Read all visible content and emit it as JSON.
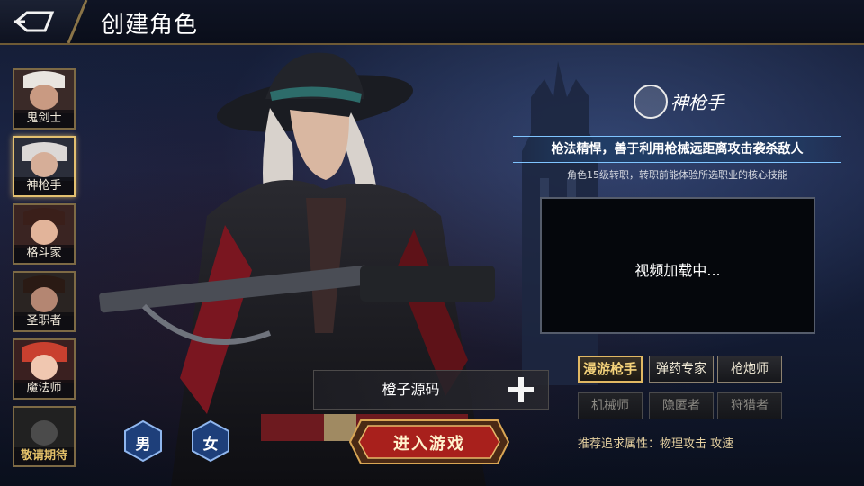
{
  "header": {
    "title": "创建角色"
  },
  "classes": [
    {
      "label": "鬼剑士",
      "selected": false,
      "locked": false
    },
    {
      "label": "神枪手",
      "selected": true,
      "locked": false
    },
    {
      "label": "格斗家",
      "selected": false,
      "locked": false
    },
    {
      "label": "圣职者",
      "selected": false,
      "locked": false
    },
    {
      "label": "魔法师",
      "selected": false,
      "locked": false
    },
    {
      "label": "敬请期待",
      "selected": false,
      "locked": true
    }
  ],
  "class_info": {
    "name": "神枪手",
    "description": "枪法精悍，善于利用枪械远距离攻击袭杀敌人",
    "note": "角色15级转职，转职前能体验所选职业的核心技能"
  },
  "video": {
    "status": "视频加载中..."
  },
  "subclasses": [
    {
      "label": "漫游枪手",
      "state": "active"
    },
    {
      "label": "弹药专家",
      "state": "normal"
    },
    {
      "label": "枪炮师",
      "state": "normal"
    },
    {
      "label": "机械师",
      "state": "disabled"
    },
    {
      "label": "隐匿者",
      "state": "disabled"
    },
    {
      "label": "狩猎者",
      "state": "disabled"
    }
  ],
  "recommend": {
    "text": "推荐追求属性：物理攻击  攻速"
  },
  "name_input": {
    "value": "橙子源码"
  },
  "gender": {
    "male": "男",
    "female": "女"
  },
  "enter_button": {
    "label": "进入游戏"
  },
  "colors": {
    "accent_gold": "#e1b863",
    "enter_red": "#a8201c",
    "gender_blue": "#2a5aa8"
  }
}
